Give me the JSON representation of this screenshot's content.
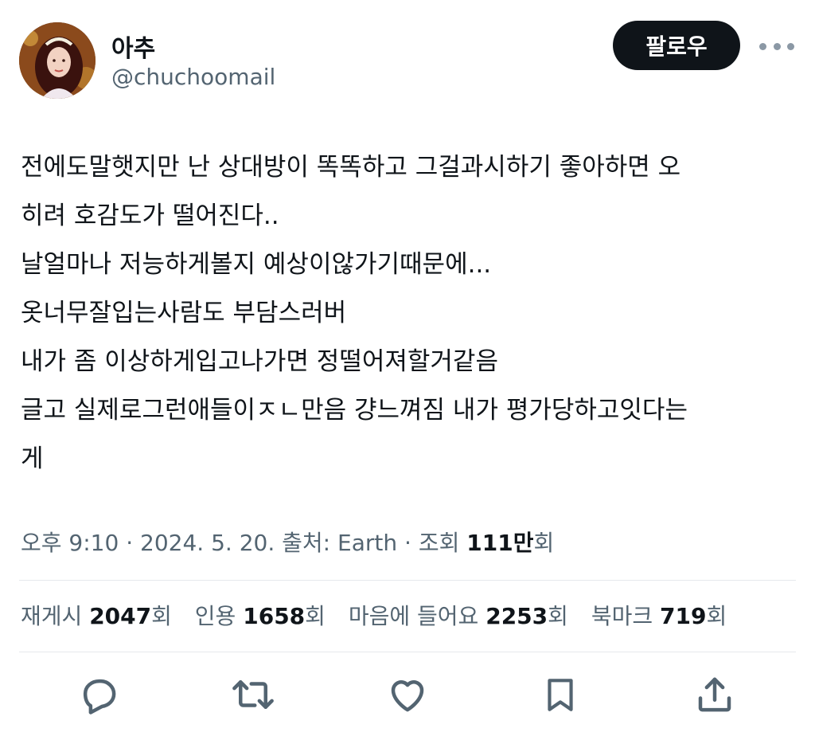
{
  "user": {
    "display_name": "아추",
    "handle": "@chuchoomail"
  },
  "header": {
    "follow_label": "팔로우"
  },
  "tweet": {
    "lines": [
      "전에도말햇지만  난 상대방이 똑똑하고 그걸과시하기 좋아하면 오",
      "히려 호감도가 떨어진다..",
      "날얼마나 저능하게볼지 예상이않가기때문에...",
      "옷너무잘입는사람도 부담스러버",
      "내가 좀 이상하게입고나가면  정떨어져할거같음",
      "글고 실제로그런애들이ㅈㄴ만음 걍느껴짐 내가 평가당하고잇다는",
      "게"
    ]
  },
  "meta": {
    "time": "오후 9:10",
    "date": "2024. 5. 20.",
    "source_label": "출처:",
    "source": "Earth",
    "views_label": "조회",
    "views_value": "111만",
    "views_suffix": "회",
    "separator": "·"
  },
  "stats": {
    "retweets_label": "재게시",
    "retweets_value": "2047",
    "quotes_label": "인용",
    "quotes_value": "1658",
    "likes_label": "마음에 들어요",
    "likes_value": "2253",
    "bookmarks_label": "북마크",
    "bookmarks_value": "719",
    "unit": "회"
  },
  "icons": {
    "reply": "reply-icon",
    "retweet": "retweet-icon",
    "like": "heart-icon",
    "bookmark": "bookmark-icon",
    "share": "share-icon",
    "more": "more-icon"
  },
  "colors": {
    "text": "#0f1419",
    "secondary": "#536471",
    "follow_bg": "#0f1419",
    "divider": "#e6e9ec"
  }
}
